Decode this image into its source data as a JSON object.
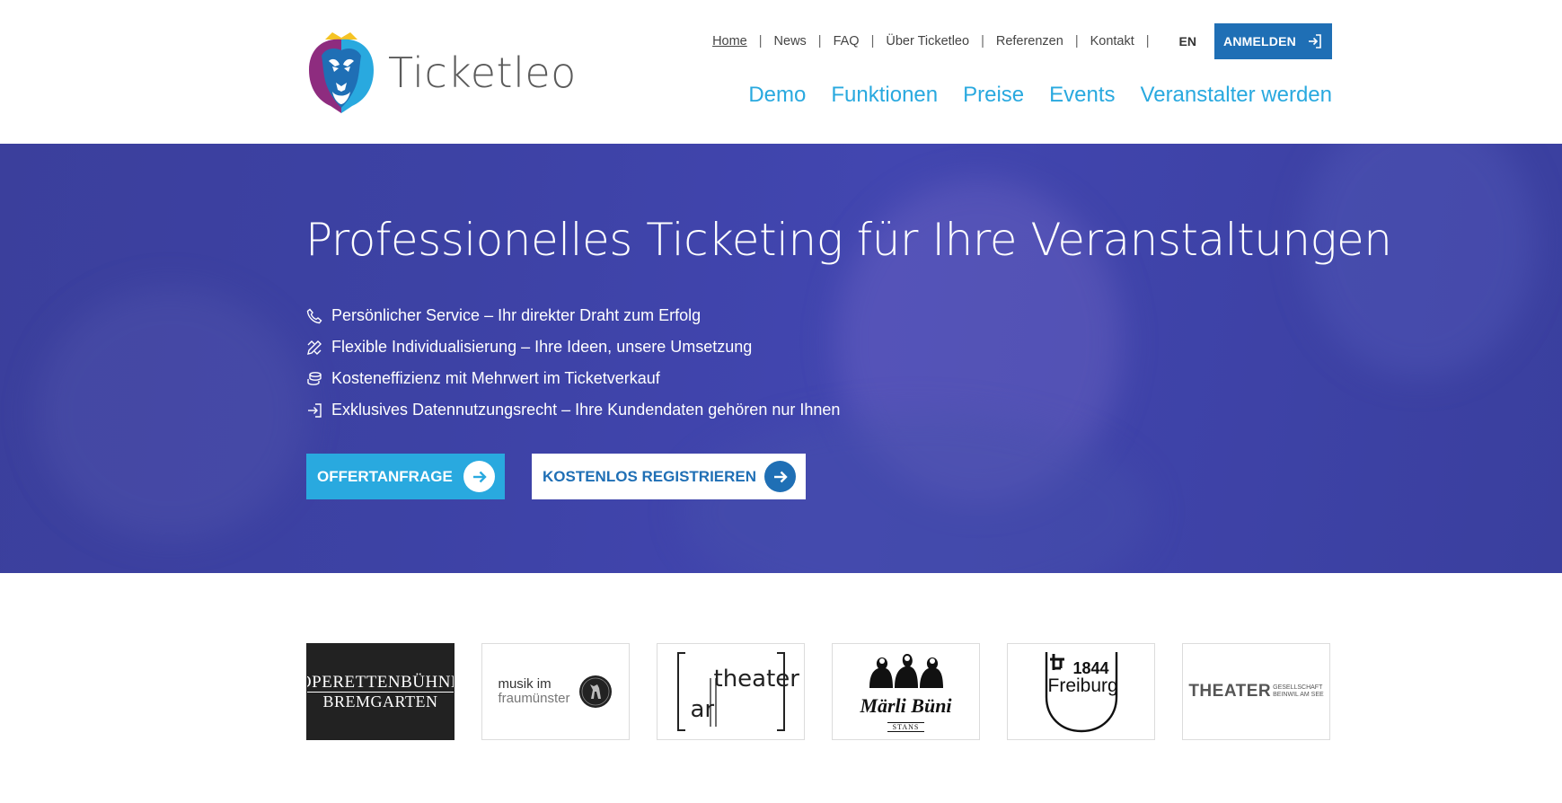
{
  "brand": {
    "name": "Ticketleo",
    "accent": "#29a9df",
    "primary": "#1f6fb5",
    "hero_bg": "#3d42a5"
  },
  "topnav": {
    "items": [
      "Home",
      "News",
      "FAQ",
      "Über Ticketleo",
      "Referenzen",
      "Kontakt"
    ],
    "lang": "EN",
    "login_label": "ANMELDEN"
  },
  "mainnav": [
    "Demo",
    "Funktionen",
    "Preise",
    "Events",
    "Veranstalter werden"
  ],
  "hero": {
    "title": "Professionelles Ticketing für Ihre Veranstaltungen",
    "features": [
      {
        "icon": "phone-icon",
        "text": "Persönlicher Service – Ihr direkter Draht zum Erfolg"
      },
      {
        "icon": "pencil-ruler-icon",
        "text": "Flexible Individualisierung – Ihre Ideen, unsere Umsetzung"
      },
      {
        "icon": "coins-icon",
        "text": "Kosteneffizienz mit Mehrwert im Ticketverkauf"
      },
      {
        "icon": "sign-in-icon",
        "text": "Exklusives Datennutzungsrecht – Ihre Kundendaten gehören nur Ihnen"
      }
    ],
    "offer_button": "OFFERTANFRAGE",
    "register_button": "KOSTENLOS REGISTRIEREN"
  },
  "references": {
    "operette": {
      "line1": "OPERETTENBÜHNE",
      "line2": "BREMGARTEN"
    },
    "musik": {
      "line1": "musik im",
      "line2": "fraumünster"
    },
    "arth": {
      "a": "ar",
      "b": "theater"
    },
    "marli": {
      "name": "Märli Büni",
      "sub": "STANS"
    },
    "freiburg": {
      "year": "1844",
      "name": "Freiburg"
    },
    "theater": {
      "big": "THEATER",
      "small1": "GESELLSCHAFT",
      "small2": "BEINWIL AM SEE"
    }
  }
}
